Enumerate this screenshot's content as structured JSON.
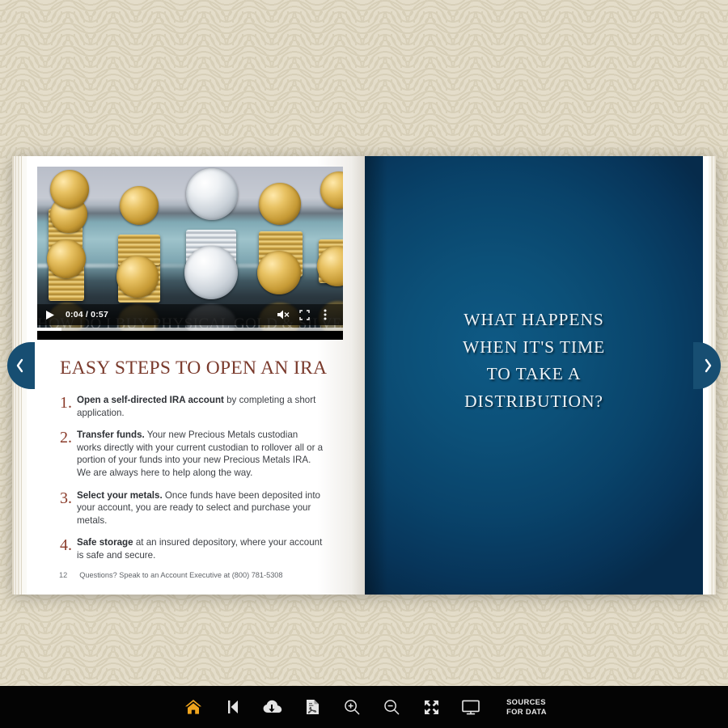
{
  "wallpaper": {
    "color": "#e4ddca",
    "pattern": "seigaiha-waves"
  },
  "book": {
    "left_page": {
      "video": {
        "title_overlay": "HOW DO I BUY PHYSICAL GOLD & SILVER?",
        "current_time": "0:04",
        "duration": "0:57",
        "time_display": "0:04 / 0:57",
        "progress_percent": 8,
        "buffered_percent": 100,
        "play_icon": "play-icon",
        "mute_icon": "muted-volume-icon",
        "fullscreen_icon": "fullscreen-icon",
        "more_icon": "more-options-kebab-icon",
        "poster_alt": "stacks of gold and silver bullion coins on a glass shelf"
      },
      "heading": "EASY STEPS TO OPEN AN IRA",
      "steps": [
        {
          "number": "1.",
          "bold": "Open a self-directed IRA account",
          "rest": " by completing a short application."
        },
        {
          "number": "2.",
          "bold": "Transfer funds.",
          "rest": " Your new Precious Metals custodian works directly with your current custodian to rollover all or a portion of your funds into your new Precious Metals IRA. We are always here to help along the way."
        },
        {
          "number": "3.",
          "bold": "Select your metals.",
          "rest": " Once funds have been deposited into your account, you are ready to select and purchase your metals."
        },
        {
          "number": "4.",
          "bold": "Safe storage",
          "rest": " at an insured depository, where your account is safe and secure."
        }
      ],
      "footer": {
        "page_number": "12",
        "text": "Questions? Speak to an Account Executive at (800) 781-5308"
      }
    },
    "right_page": {
      "background_color": "#0c5078",
      "title_lines": [
        "WHAT HAPPENS",
        "WHEN IT'S TIME",
        "TO TAKE A",
        "DISTRIBUTION?"
      ]
    }
  },
  "navigation": {
    "prev": {
      "name": "previous-page",
      "icon": "chevron-left-icon"
    },
    "next": {
      "name": "next-page",
      "icon": "chevron-right-icon"
    },
    "color": "#174e72"
  },
  "toolbar": {
    "background": "#040404",
    "home_icon": "home-icon",
    "home_color": "#f0a51e",
    "first_page_icon": "skip-to-first-page-icon",
    "download_icon": "cloud-download-icon",
    "pdf_icon": "pdf-document-icon",
    "zoom_in_icon": "zoom-in-icon",
    "zoom_out_icon": "zoom-out-icon",
    "expand_icon": "expand-arrows-icon",
    "presentation_icon": "monitor-presentation-icon",
    "sources_line1": "SOURCES",
    "sources_line2": "FOR DATA"
  }
}
